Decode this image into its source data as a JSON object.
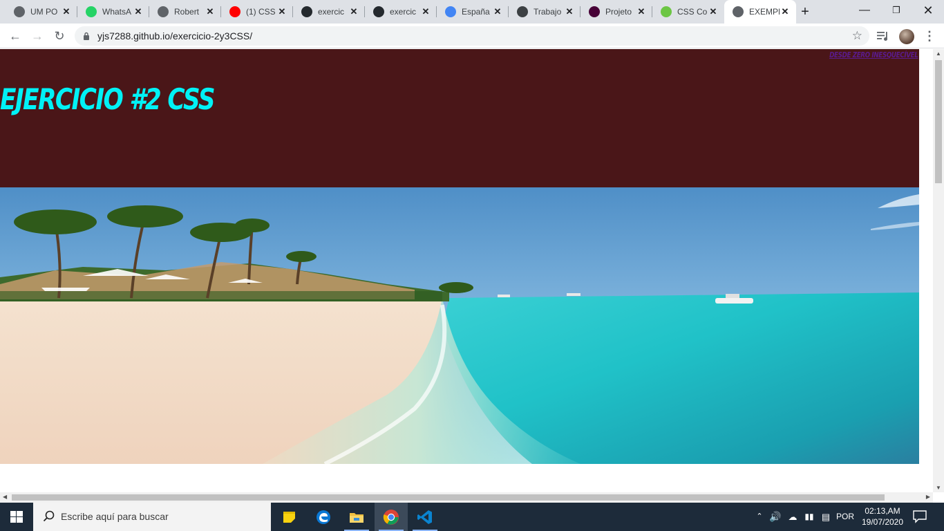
{
  "browser": {
    "tabs": [
      {
        "title": "UM PO",
        "favicon": "globe-icon",
        "color": "#5f6368"
      },
      {
        "title": "WhatsA",
        "favicon": "whatsapp-icon",
        "color": "#25d366"
      },
      {
        "title": "Robert",
        "favicon": "globe-icon",
        "color": "#5f6368"
      },
      {
        "title": "(1) CSS",
        "favicon": "youtube-icon",
        "color": "#ff0000"
      },
      {
        "title": "exercic",
        "favicon": "github-icon",
        "color": "#24292e"
      },
      {
        "title": "exercic",
        "favicon": "github-icon",
        "color": "#24292e"
      },
      {
        "title": "España",
        "favicon": "espana-icon",
        "color": "#4285f4"
      },
      {
        "title": "Trabajo",
        "favicon": "contact-icon",
        "color": "#3c4043"
      },
      {
        "title": "Projeto",
        "favicon": "adobe-xd-icon",
        "color": "#470137"
      },
      {
        "title": "CSS Co",
        "favicon": "w3-icon",
        "color": "#6cc644"
      },
      {
        "title": "EXEMPL",
        "favicon": "globe-icon",
        "color": "#5f6368",
        "active": true
      }
    ],
    "new_tab_label": "+",
    "url": "yjs7288.github.io/exercicio-2y3CSS/"
  },
  "page": {
    "title": "Ejercicio #2 CSS",
    "nav_link": "Desde zero Inesquecível",
    "header_bg": "#4a1618",
    "title_color": "#00f2f6",
    "link_color": "#5a1a8c",
    "hero_image": "beach-photo"
  },
  "taskbar": {
    "search_placeholder": "Escribe aquí para buscar",
    "apps": [
      "sticky-notes-icon",
      "edge-icon",
      "file-explorer-icon",
      "chrome-icon",
      "vscode-icon"
    ],
    "language": "POR",
    "time": "02:13,AM",
    "date": "19/07/2020"
  }
}
